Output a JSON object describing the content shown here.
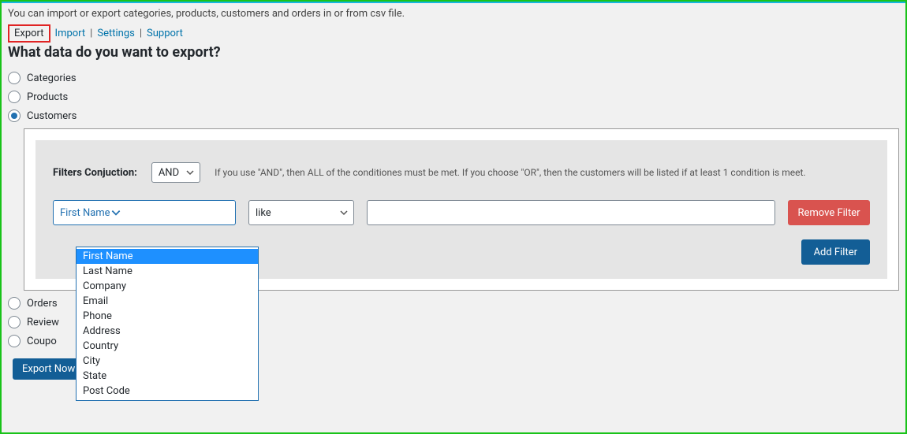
{
  "intro": "You can import or export categories, products, customers and orders in or from csv file.",
  "tabs": {
    "export": "Export",
    "import": "Import",
    "settings": "Settings",
    "support": "Support"
  },
  "heading": "What data do you want to export?",
  "options": {
    "categories": "Categories",
    "products": "Products",
    "customers": "Customers",
    "orders": "Orders",
    "reviews": "Review",
    "coupons": "Coupo"
  },
  "filter": {
    "conjuction_label": "Filters Conjuction:",
    "conjuction_value": "AND",
    "hint": "If you use \"AND\", then ALL of the conditiones must be met. If you choose \"OR\", then the customers will be listed if at least 1 condition is meet.",
    "field_value": "First Name",
    "operator_value": "like",
    "value": "",
    "remove_label": "Remove Filter",
    "add_label": "Add Filter"
  },
  "field_options": [
    "First Name",
    "Last Name",
    "Company",
    "Email",
    "Phone",
    "Address",
    "Country",
    "City",
    "State",
    "Post Code"
  ],
  "export_button": "Export Now!"
}
